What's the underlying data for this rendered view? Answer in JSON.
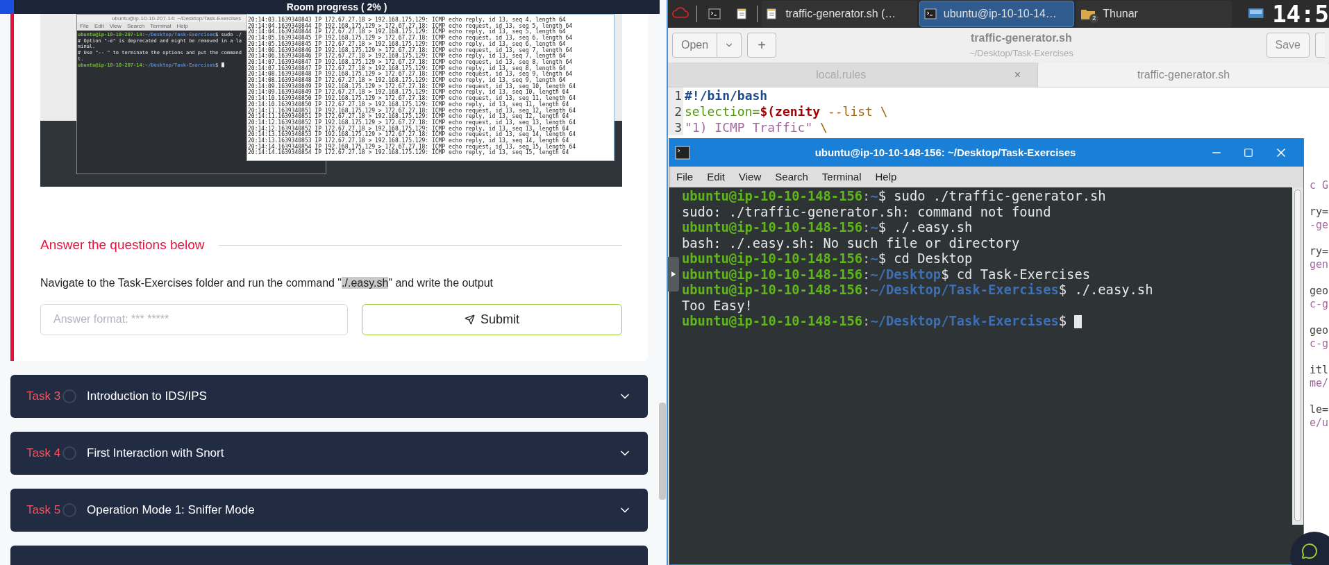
{
  "room_progress": "Room progress ( 2% )",
  "task_image": {
    "terminal_title": "ubuntu@ip-10-10-207-14: ~/Desktop/Task-Exercises",
    "terminal_menu": [
      "File",
      "Edit",
      "View",
      "Search",
      "Terminal",
      "Help"
    ],
    "terminal_lines": [
      {
        "kind": "prompt",
        "user": "ubuntu@ip-10-10-207-14",
        "sep": ":",
        "path": "~/Desktop/Task-Exercises",
        "rest": "$ sudo ./"
      },
      {
        "kind": "output",
        "text": "# Option \"-e\" is deprecated and might be removed in a la"
      },
      {
        "kind": "output",
        "text": "minal."
      },
      {
        "kind": "output",
        "text": "# Use \"-- \" to terminate the options and put the command"
      },
      {
        "kind": "output",
        "text": "t."
      },
      {
        "kind": "prompt",
        "user": "ubuntu@ip-10-10-207-14",
        "sep": ":",
        "path": "~/Desktop/Task-Exercises",
        "rest": "$ ",
        "cursor": true
      }
    ],
    "capture_lines": [
      "20:14:03.1639340843 IP 172.67.27.18 > 192.168.175.129: ICMP echo reply, id 13, seq 4, length 64",
      "20:14:04.1639340844 IP 192.168.175.129 > 172.67.27.18: ICMP echo request, id 13, seq 5, length 64",
      "20:14:04.1639340844 IP 172.67.27.18 > 192.168.175.129: ICMP echo reply, id 13, seq 5, length 64",
      "20:14:05.1639340845 IP 192.168.175.129 > 172.67.27.18: ICMP echo request, id 13, seq 6, length 64",
      "20:14:05.1639340845 IP 172.67.27.18 > 192.168.175.129: ICMP echo reply, id 13, seq 6, length 64",
      "20:14:06.1639340846 IP 192.168.175.129 > 172.67.27.18: ICMP echo request, id 13, seq 7, length 64",
      "20:14:06.1639340846 IP 172.67.27.18 > 192.168.175.129: ICMP echo reply, id 13, seq 7, length 64",
      "20:14:07.1639340847 IP 192.168.175.129 > 172.67.27.18: ICMP echo request, id 13, seq 8, length 64",
      "20:14:07.1639340847 IP 172.67.27.18 > 192.168.175.129: ICMP echo reply, id 13, seq 8, length 64",
      "20:14:08.1639340848 IP 192.168.175.129 > 172.67.27.18: ICMP echo request, id 13, seq 9, length 64",
      "20:14:08.1639340848 IP 172.67.27.18 > 192.168.175.129: ICMP echo reply, id 13, seq 9, length 64",
      "20:14:09.1639340849 IP 192.168.175.129 > 172.67.27.18: ICMP echo request, id 13, seq 10, length 64",
      "20:14:09.1639340849 IP 172.67.27.18 > 192.168.175.129: ICMP echo reply, id 13, seq 10, length 64",
      "20:14:10.1639340850 IP 192.168.175.129 > 172.67.27.18: ICMP echo request, id 13, seq 11, length 64",
      "20:14:10.1639340850 IP 172.67.27.18 > 192.168.175.129: ICMP echo reply, id 13, seq 11, length 64",
      "20:14:11.1639340851 IP 192.168.175.129 > 172.67.27.18: ICMP echo request, id 13, seq 12, length 64",
      "20:14:11.1639340851 IP 172.67.27.18 > 192.168.175.129: ICMP echo reply, id 13, seq 12, length 64",
      "20:14:12.1639340852 IP 192.168.175.129 > 172.67.27.18: ICMP echo request, id 13, seq 13, length 64",
      "20:14:12.1639340852 IP 172.67.27.18 > 192.168.175.129: ICMP echo reply, id 13, seq 13, length 64",
      "20:14:13.1639340853 IP 192.168.175.129 > 172.67.27.18: ICMP echo request, id 13, seq 14, length 64",
      "20:14:13.1639340853 IP 172.67.27.18 > 192.168.175.129: ICMP echo reply, id 13, seq 14, length 64",
      "20:14:14.1639340854 IP 192.168.175.129 > 172.67.27.18: ICMP echo request, id 13, seq 15, length 64",
      "20:14:14.1639340854 IP 172.67.27.18 > 192.168.175.129: ICMP echo reply, id 13, seq 15, length 64"
    ]
  },
  "questions_heading": "Answer the questions below",
  "question": {
    "before": "Navigate to the Task-Exercises folder and run the command \"",
    "highlight": "./.easy.sh",
    "after": "\" and write the output"
  },
  "answer_field": {
    "placeholder": "Answer format: *** *****"
  },
  "submit_button": "Submit",
  "tasks": [
    {
      "label": "Task 3",
      "title": "Introduction to IDS/IPS",
      "done": false,
      "expanded": false
    },
    {
      "label": "Task 4",
      "title": "First Interaction with Snort",
      "done": false,
      "expanded": false
    },
    {
      "label": "Task 5",
      "title": "Operation Mode 1: Sniffer Mode",
      "done": false,
      "expanded": false
    }
  ],
  "taskbar": {
    "windows": [
      {
        "kind": "editor",
        "label": "traffic-generator.sh (…",
        "selected": false
      },
      {
        "kind": "terminal",
        "label": "ubuntu@ip-10-10-14…",
        "selected": true
      },
      {
        "kind": "folder",
        "label": "Thunar",
        "badge": "2",
        "selected": false
      }
    ],
    "clock": "14:5"
  },
  "editor": {
    "open_button": "Open",
    "new_button": "+",
    "title": "traffic-generator.sh",
    "subtitle": "~/Desktop/Task-Exercises",
    "save_button": "Save",
    "tabs": [
      {
        "label": "local.rules",
        "close": "×",
        "selected": false
      },
      {
        "label": "traffic-generator.sh",
        "selected": true
      }
    ],
    "code_lines": [
      {
        "number": "1",
        "segments": [
          {
            "text": "#!/bin/bash",
            "color": "#1d4a8c",
            "bold": true
          }
        ]
      },
      {
        "number": "2",
        "segments": [
          {
            "text": "selection=",
            "color": "#4e9a06",
            "bold": false
          },
          {
            "text": "$(zenity",
            "color": "#a40000",
            "bold": true
          },
          {
            "text": " --list \\",
            "color": "#a0650a",
            "bold": false
          }
        ]
      },
      {
        "number": "3",
        "segments": [
          {
            "text": "\"1) ICMP Traffic\"",
            "color": "#a3699e",
            "bold": false
          },
          {
            "text": " \\",
            "color": "#a0650a",
            "bold": false
          }
        ]
      }
    ],
    "edge_fragments": [
      [
        {
          "text": "c G",
          "kind": "value"
        }
      ],
      [
        {
          "text": "ry=",
          "kind": "key"
        },
        {
          "text": "-ge",
          "kind": "value"
        }
      ],
      [
        {
          "text": "ry=",
          "kind": "key"
        },
        {
          "text": "gen",
          "kind": "value"
        }
      ],
      [
        {
          "text": "geo",
          "kind": "key"
        },
        {
          "text": "c-g",
          "kind": "value"
        }
      ],
      [
        {
          "text": "geo",
          "kind": "key"
        },
        {
          "text": "c-g",
          "kind": "value"
        }
      ],
      [
        {
          "text": "itl",
          "kind": "key"
        },
        {
          "text": "me/",
          "kind": "value"
        }
      ],
      [
        {
          "text": "le=",
          "kind": "key"
        },
        {
          "text": "e/u",
          "kind": "value"
        }
      ]
    ]
  },
  "terminal": {
    "title": "ubuntu@ip-10-10-148-156: ~/Desktop/Task-Exercises",
    "menu": [
      "File",
      "Edit",
      "View",
      "Search",
      "Terminal",
      "Help"
    ],
    "lines": [
      {
        "kind": "prompt",
        "user": "ubuntu@ip-10-10-148-156",
        "sep": ":",
        "path": "~",
        "rest": "$ sudo ./traffic-generator.sh"
      },
      {
        "kind": "output",
        "text": "sudo: ./traffic-generator.sh: command not found"
      },
      {
        "kind": "prompt",
        "user": "ubuntu@ip-10-10-148-156",
        "sep": ":",
        "path": "~",
        "rest": "$ ./.easy.sh"
      },
      {
        "kind": "output",
        "text": "bash: ./.easy.sh: No such file or directory"
      },
      {
        "kind": "prompt",
        "user": "ubuntu@ip-10-10-148-156",
        "sep": ":",
        "path": "~",
        "rest": "$ cd Desktop"
      },
      {
        "kind": "prompt",
        "user": "ubuntu@ip-10-10-148-156",
        "sep": ":",
        "path": "~/Desktop",
        "rest": "$ cd Task-Exercises"
      },
      {
        "kind": "prompt",
        "user": "ubuntu@ip-10-10-148-156",
        "sep": ":",
        "path": "~/Desktop/Task-Exercises",
        "rest": "$ ./.easy.sh"
      },
      {
        "kind": "output",
        "text": "Too Easy!"
      },
      {
        "kind": "prompt",
        "user": "ubuntu@ip-10-10-148-156",
        "sep": ":",
        "path": "~/Desktop/Task-Exercises",
        "rest": "$ ",
        "cursor": true
      }
    ]
  }
}
